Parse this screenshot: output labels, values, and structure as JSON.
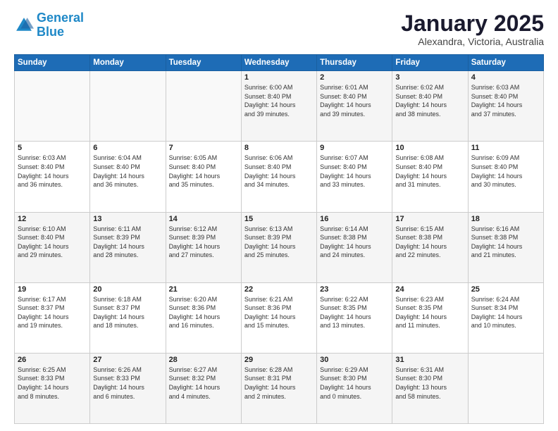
{
  "header": {
    "logo_general": "General",
    "logo_blue": "Blue",
    "month": "January 2025",
    "location": "Alexandra, Victoria, Australia"
  },
  "days_of_week": [
    "Sunday",
    "Monday",
    "Tuesday",
    "Wednesday",
    "Thursday",
    "Friday",
    "Saturday"
  ],
  "weeks": [
    [
      {
        "day": "",
        "info": ""
      },
      {
        "day": "",
        "info": ""
      },
      {
        "day": "",
        "info": ""
      },
      {
        "day": "1",
        "info": "Sunrise: 6:00 AM\nSunset: 8:40 PM\nDaylight: 14 hours\nand 39 minutes."
      },
      {
        "day": "2",
        "info": "Sunrise: 6:01 AM\nSunset: 8:40 PM\nDaylight: 14 hours\nand 39 minutes."
      },
      {
        "day": "3",
        "info": "Sunrise: 6:02 AM\nSunset: 8:40 PM\nDaylight: 14 hours\nand 38 minutes."
      },
      {
        "day": "4",
        "info": "Sunrise: 6:03 AM\nSunset: 8:40 PM\nDaylight: 14 hours\nand 37 minutes."
      }
    ],
    [
      {
        "day": "5",
        "info": "Sunrise: 6:03 AM\nSunset: 8:40 PM\nDaylight: 14 hours\nand 36 minutes."
      },
      {
        "day": "6",
        "info": "Sunrise: 6:04 AM\nSunset: 8:40 PM\nDaylight: 14 hours\nand 36 minutes."
      },
      {
        "day": "7",
        "info": "Sunrise: 6:05 AM\nSunset: 8:40 PM\nDaylight: 14 hours\nand 35 minutes."
      },
      {
        "day": "8",
        "info": "Sunrise: 6:06 AM\nSunset: 8:40 PM\nDaylight: 14 hours\nand 34 minutes."
      },
      {
        "day": "9",
        "info": "Sunrise: 6:07 AM\nSunset: 8:40 PM\nDaylight: 14 hours\nand 33 minutes."
      },
      {
        "day": "10",
        "info": "Sunrise: 6:08 AM\nSunset: 8:40 PM\nDaylight: 14 hours\nand 31 minutes."
      },
      {
        "day": "11",
        "info": "Sunrise: 6:09 AM\nSunset: 8:40 PM\nDaylight: 14 hours\nand 30 minutes."
      }
    ],
    [
      {
        "day": "12",
        "info": "Sunrise: 6:10 AM\nSunset: 8:40 PM\nDaylight: 14 hours\nand 29 minutes."
      },
      {
        "day": "13",
        "info": "Sunrise: 6:11 AM\nSunset: 8:39 PM\nDaylight: 14 hours\nand 28 minutes."
      },
      {
        "day": "14",
        "info": "Sunrise: 6:12 AM\nSunset: 8:39 PM\nDaylight: 14 hours\nand 27 minutes."
      },
      {
        "day": "15",
        "info": "Sunrise: 6:13 AM\nSunset: 8:39 PM\nDaylight: 14 hours\nand 25 minutes."
      },
      {
        "day": "16",
        "info": "Sunrise: 6:14 AM\nSunset: 8:38 PM\nDaylight: 14 hours\nand 24 minutes."
      },
      {
        "day": "17",
        "info": "Sunrise: 6:15 AM\nSunset: 8:38 PM\nDaylight: 14 hours\nand 22 minutes."
      },
      {
        "day": "18",
        "info": "Sunrise: 6:16 AM\nSunset: 8:38 PM\nDaylight: 14 hours\nand 21 minutes."
      }
    ],
    [
      {
        "day": "19",
        "info": "Sunrise: 6:17 AM\nSunset: 8:37 PM\nDaylight: 14 hours\nand 19 minutes."
      },
      {
        "day": "20",
        "info": "Sunrise: 6:18 AM\nSunset: 8:37 PM\nDaylight: 14 hours\nand 18 minutes."
      },
      {
        "day": "21",
        "info": "Sunrise: 6:20 AM\nSunset: 8:36 PM\nDaylight: 14 hours\nand 16 minutes."
      },
      {
        "day": "22",
        "info": "Sunrise: 6:21 AM\nSunset: 8:36 PM\nDaylight: 14 hours\nand 15 minutes."
      },
      {
        "day": "23",
        "info": "Sunrise: 6:22 AM\nSunset: 8:35 PM\nDaylight: 14 hours\nand 13 minutes."
      },
      {
        "day": "24",
        "info": "Sunrise: 6:23 AM\nSunset: 8:35 PM\nDaylight: 14 hours\nand 11 minutes."
      },
      {
        "day": "25",
        "info": "Sunrise: 6:24 AM\nSunset: 8:34 PM\nDaylight: 14 hours\nand 10 minutes."
      }
    ],
    [
      {
        "day": "26",
        "info": "Sunrise: 6:25 AM\nSunset: 8:33 PM\nDaylight: 14 hours\nand 8 minutes."
      },
      {
        "day": "27",
        "info": "Sunrise: 6:26 AM\nSunset: 8:33 PM\nDaylight: 14 hours\nand 6 minutes."
      },
      {
        "day": "28",
        "info": "Sunrise: 6:27 AM\nSunset: 8:32 PM\nDaylight: 14 hours\nand 4 minutes."
      },
      {
        "day": "29",
        "info": "Sunrise: 6:28 AM\nSunset: 8:31 PM\nDaylight: 14 hours\nand 2 minutes."
      },
      {
        "day": "30",
        "info": "Sunrise: 6:29 AM\nSunset: 8:30 PM\nDaylight: 14 hours\nand 0 minutes."
      },
      {
        "day": "31",
        "info": "Sunrise: 6:31 AM\nSunset: 8:30 PM\nDaylight: 13 hours\nand 58 minutes."
      },
      {
        "day": "",
        "info": ""
      }
    ]
  ]
}
